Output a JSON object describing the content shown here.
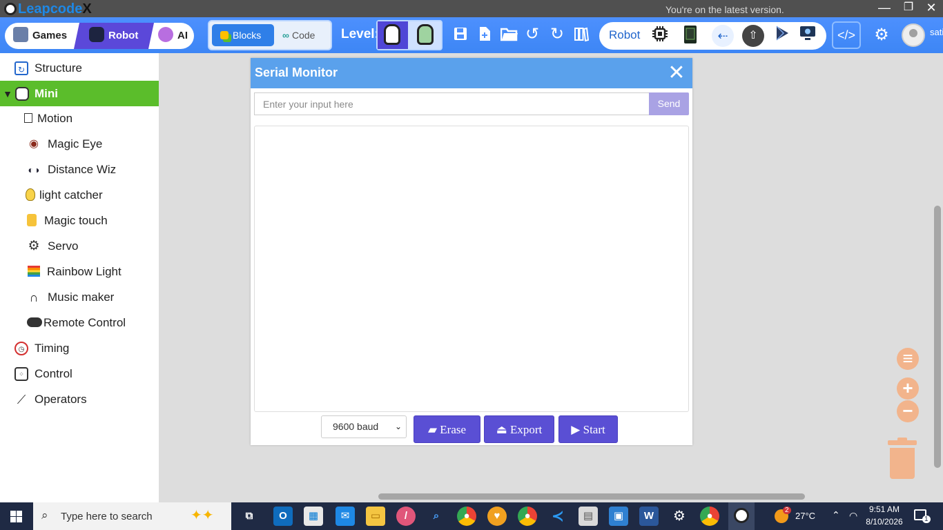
{
  "window": {
    "app_name_part1": "Leap",
    "app_name_part2": "code",
    "app_name_part3": "X",
    "update_message": "You're on the latest version.",
    "controls": {
      "minimize": "—",
      "maximize": "❐",
      "close": "✕"
    }
  },
  "toolbar": {
    "modes": [
      {
        "label": "Games",
        "icon": "games-icon"
      },
      {
        "label": "Robot",
        "icon": "robot-icon",
        "active": true
      },
      {
        "label": "AI",
        "icon": "brain-icon"
      }
    ],
    "editor_tabs": {
      "blocks": "Blocks",
      "code": "Code"
    },
    "level_label": "Level:",
    "robot_label": "Robot",
    "user_name": "sati",
    "icons": [
      "save-icon",
      "new-file-icon",
      "open-folder-icon",
      "undo-icon",
      "redo-icon",
      "book-icon"
    ],
    "robot_icons": [
      "chip-icon",
      "board-icon",
      "usb-icon",
      "upload-icon",
      "play-store-icon",
      "monitor-icon"
    ]
  },
  "sidebar": {
    "items": [
      {
        "label": "Structure",
        "icon": "structure-icon",
        "level": 0
      },
      {
        "label": "Mini",
        "icon": "mini-robot-icon",
        "level": 0,
        "expanded": true
      },
      {
        "label": "Motion",
        "icon": "motion-icon",
        "level": 1
      },
      {
        "label": "Magic Eye",
        "icon": "eye-icon",
        "level": 1
      },
      {
        "label": "Distance Wiz",
        "icon": "glasses-icon",
        "level": 1
      },
      {
        "label": "light catcher",
        "icon": "lightbulb-icon",
        "level": 1
      },
      {
        "label": "Magic touch",
        "icon": "touch-icon",
        "level": 1
      },
      {
        "label": "Servo",
        "icon": "gear-icon",
        "level": 1
      },
      {
        "label": "Rainbow Light",
        "icon": "rainbow-flag-icon",
        "level": 1
      },
      {
        "label": "Music maker",
        "icon": "headphones-icon",
        "level": 1
      },
      {
        "label": "Remote Control",
        "icon": "gamepad-icon",
        "level": 1
      },
      {
        "label": "Timing",
        "icon": "alarm-clock-icon",
        "level": 0
      },
      {
        "label": "Control",
        "icon": "control-icon",
        "level": 0
      },
      {
        "label": "Operators",
        "icon": "operators-icon",
        "level": 0
      }
    ]
  },
  "serial_monitor": {
    "title": "Serial Monitor",
    "input_placeholder": "Enter your input here",
    "send_label": "Send",
    "baud_selected": "9600 baud",
    "erase_label": "Erase",
    "export_label": "Export",
    "start_label": "Start"
  },
  "taskbar": {
    "search_placeholder": "Type here to search",
    "weather_temp": "27°C",
    "notification_badge": "2",
    "time": "9:51 AM",
    "date": "8/10/2026",
    "notification_count": "1"
  },
  "colors": {
    "toolbar_blue": "#4d90fe",
    "robot_mode_purple": "#5b48d9",
    "mini_category_green": "#5bbd2b",
    "serial_header_blue": "#5aa1ec",
    "serial_button_purple": "#5a4fd4",
    "zoom_controls_orange": "#f2b48c"
  }
}
